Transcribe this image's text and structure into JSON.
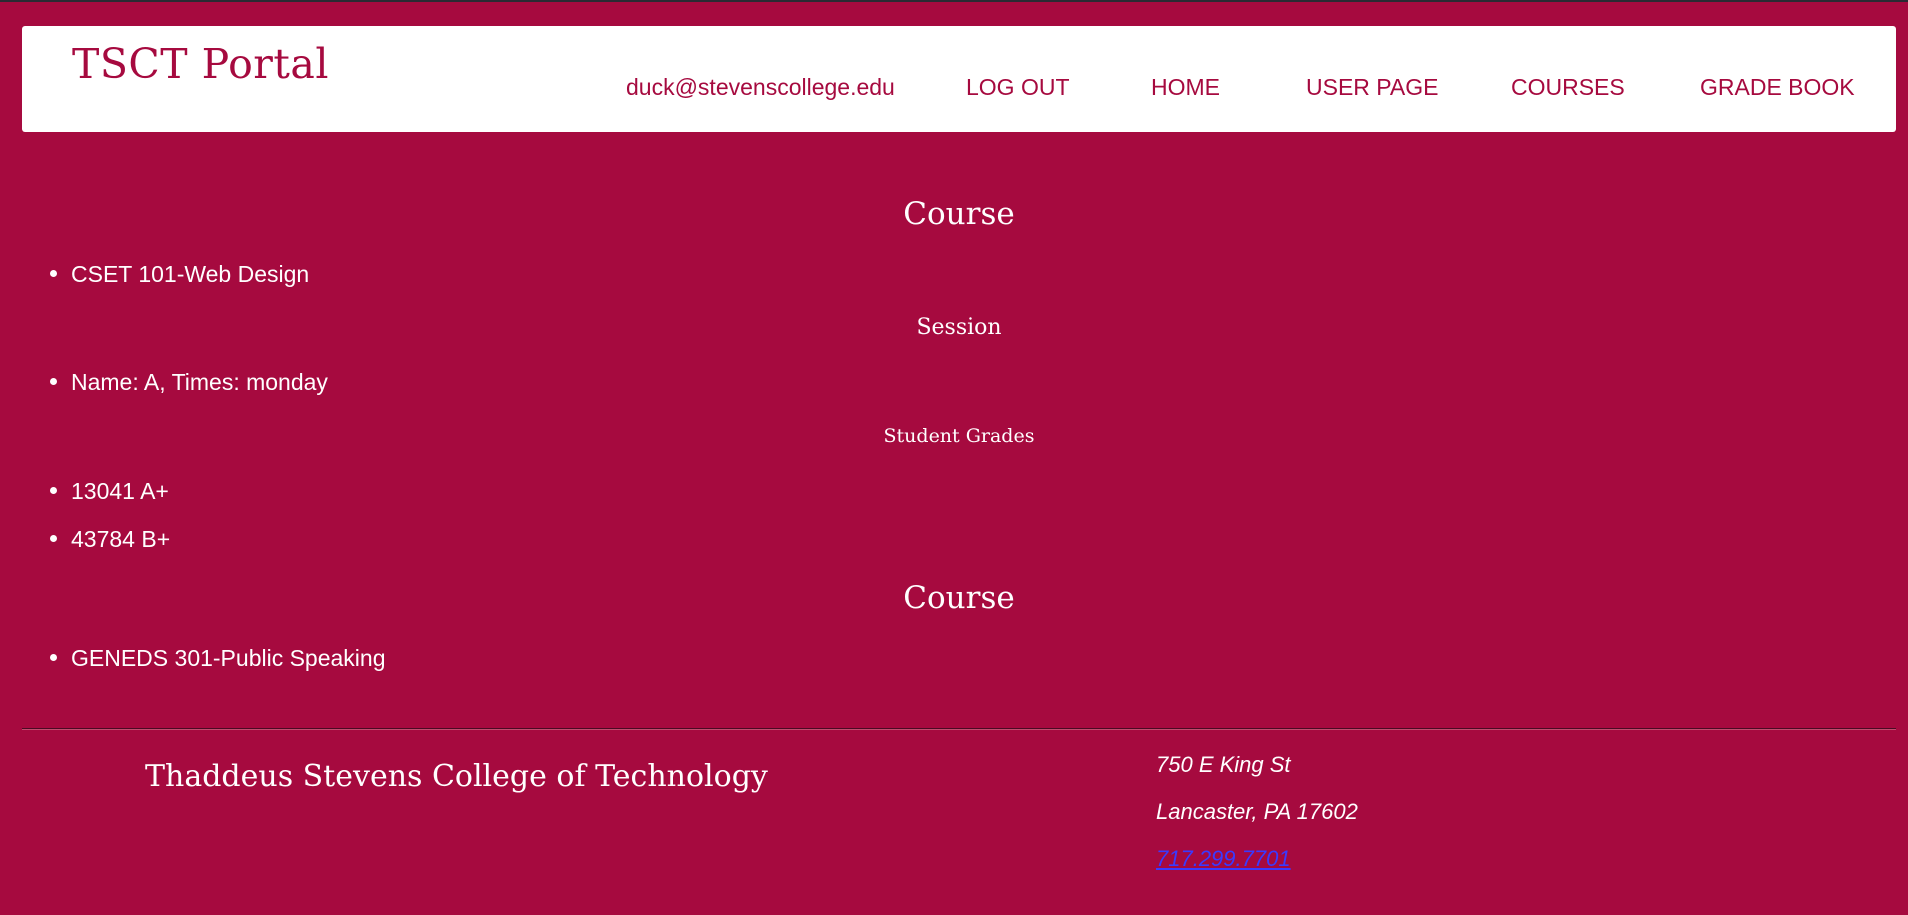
{
  "header": {
    "brand": "TSCT Portal",
    "nav": {
      "email": "duck@stevenscollege.edu",
      "logout": "LOG OUT",
      "home": "HOME",
      "user_page": "USER PAGE",
      "courses": "COURSES",
      "grade_book": "GRADE BOOK"
    }
  },
  "main": {
    "courses": [
      {
        "heading": "Course",
        "name": "CSET 101-Web Design",
        "session_heading": "Session",
        "session": "Name: A, Times: monday",
        "grades_heading": "Student Grades",
        "grades": [
          "13041 A+",
          "43784 B+"
        ]
      },
      {
        "heading": "Course",
        "name": "GENEDS 301-Public Speaking"
      }
    ]
  },
  "footer": {
    "college": "Thaddeus Stevens College of Technology",
    "street": "750 E King St",
    "city": "Lancaster, PA 17602",
    "phone": "717.299.7701"
  },
  "colors": {
    "background": "#a60a3f",
    "header_bg": "#ffffff",
    "accent_text": "#a60a3f",
    "link": "#3a3aff"
  }
}
